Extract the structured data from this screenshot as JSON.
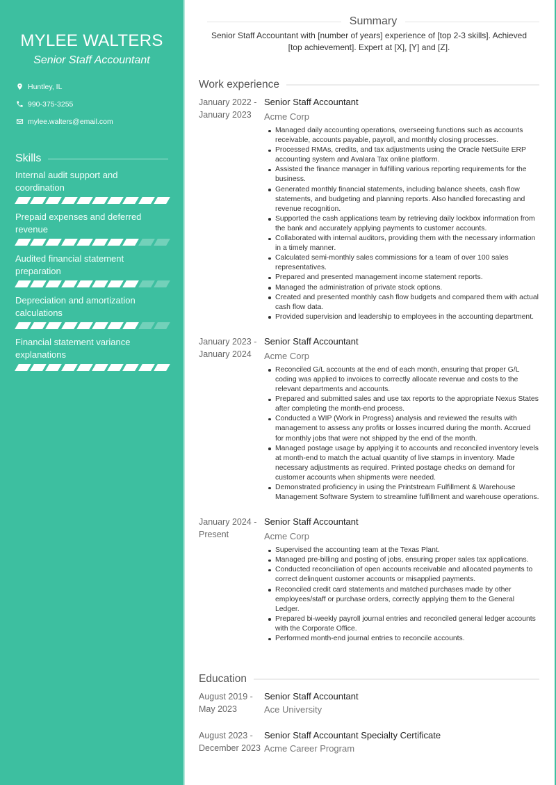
{
  "colors": {
    "accent": "#3dbfa0",
    "text": "#333333",
    "muted": "#666666"
  },
  "profile": {
    "name": "MYLEE WALTERS",
    "title": "Senior Staff Accountant",
    "contacts": [
      {
        "icon": "location-pin-icon",
        "text": "Huntley, IL"
      },
      {
        "icon": "phone-icon",
        "text": "990-375-3255"
      },
      {
        "icon": "envelope-icon",
        "text": "mylee.walters@email.com"
      }
    ]
  },
  "skills": {
    "heading": "Skills",
    "items": [
      {
        "name": "Internal audit support and coordination",
        "level": 10,
        "max": 10
      },
      {
        "name": "Prepaid expenses and deferred revenue",
        "level": 8,
        "max": 10
      },
      {
        "name": "Audited financial statement preparation",
        "level": 8,
        "max": 10
      },
      {
        "name": "Depreciation and amortization calculations",
        "level": 8,
        "max": 10
      },
      {
        "name": "Financial statement variance explanations",
        "level": 10,
        "max": 10
      }
    ]
  },
  "summary": {
    "heading": "Summary",
    "text": "Senior Staff Accountant with [number of years] experience of [top 2-3 skills]. Achieved [top achievement]. Expert at [X], [Y] and [Z]."
  },
  "work": {
    "heading": "Work experience",
    "jobs": [
      {
        "date_start": "January 2022 -",
        "date_end": "January 2023",
        "title": "Senior Staff Accountant",
        "company": "Acme Corp",
        "bullets": [
          "Managed daily accounting operations, overseeing functions such as accounts receivable, accounts payable, payroll, and monthly closing processes.",
          "Processed RMAs, credits, and tax adjustments using the Oracle NetSuite ERP accounting system and Avalara Tax online platform.",
          "Assisted the finance manager in fulfilling various reporting requirements for the business.",
          "Generated monthly financial statements, including balance sheets, cash flow statements, and budgeting and planning reports. Also handled forecasting and revenue recognition.",
          "Supported the cash applications team by retrieving daily lockbox information from the bank and accurately applying payments to customer accounts.",
          "Collaborated with internal auditors, providing them with the necessary information in a timely manner.",
          "Calculated semi-monthly sales commissions for a team of over 100 sales representatives.",
          "Prepared and presented management income statement reports.",
          "Managed the administration of private stock options.",
          "Created and presented monthly cash flow budgets and compared them with actual cash flow data.",
          "Provided supervision and leadership to employees in the accounting department."
        ]
      },
      {
        "date_start": "January 2023 -",
        "date_end": "January 2024",
        "title": "Senior Staff Accountant",
        "company": "Acme Corp",
        "bullets": [
          "Reconciled G/L accounts at the end of each month, ensuring that proper G/L coding was applied to invoices to correctly allocate revenue and costs to the relevant departments and accounts.",
          "Prepared and submitted sales and use tax reports to the appropriate Nexus States after completing the month-end process.",
          "Conducted a WIP (Work in Progress) analysis and reviewed the results with management to assess any profits or losses incurred during the month. Accrued for monthly jobs that were not shipped by the end of the month.",
          "Managed postage usage by applying it to accounts and reconciled inventory levels at month-end to match the actual quantity of live stamps in inventory. Made necessary adjustments as required. Printed postage checks on demand for customer accounts when shipments were needed.",
          "Demonstrated proficiency in using the Printstream Fulfillment & Warehouse Management Software System to streamline fulfillment and warehouse operations."
        ]
      },
      {
        "date_start": "January 2024 -",
        "date_end": "Present",
        "title": "Senior Staff Accountant",
        "company": "Acme Corp",
        "bullets": [
          "Supervised the accounting team at the Texas Plant.",
          "Managed pre-billing and posting of jobs, ensuring proper sales tax applications.",
          "Conducted reconciliation of open accounts receivable and allocated payments to correct delinquent customer accounts or misapplied payments.",
          "Reconciled credit card statements and matched purchases made by other employees/staff or purchase orders, correctly applying them to the General Ledger.",
          "Prepared bi-weekly payroll journal entries and reconciled general ledger accounts with the Corporate Office.",
          "Performed month-end journal entries to reconcile accounts."
        ]
      }
    ]
  },
  "education": {
    "heading": "Education",
    "items": [
      {
        "date_start": "August 2019 -",
        "date_end": "May 2023",
        "degree": "Senior Staff Accountant",
        "school": "Ace University"
      },
      {
        "date_start": "August 2023 -",
        "date_end": "December 2023",
        "degree": "Senior Staff Accountant Specialty Certificate",
        "school": "Acme Career Program"
      }
    ]
  }
}
